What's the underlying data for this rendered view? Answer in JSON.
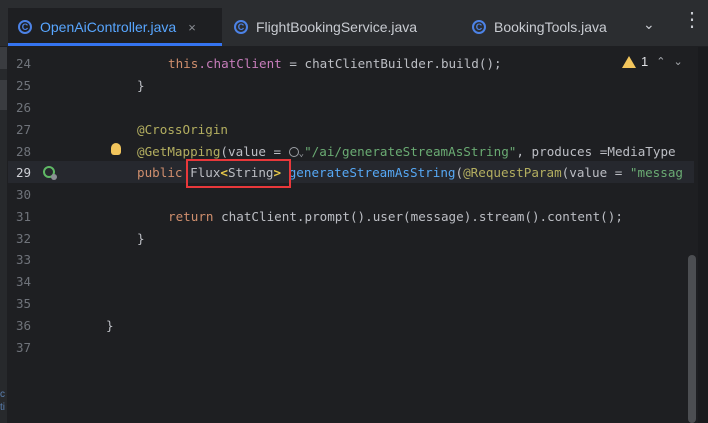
{
  "tabs": [
    {
      "label": "OpenAiController.java",
      "active": true,
      "close": "×"
    },
    {
      "label": "FlightBookingService.java",
      "active": false
    },
    {
      "label": "BookingTools.java",
      "active": false
    }
  ],
  "tab_icon_letter": "C",
  "tab_overflow_icon": "chevron-down-icon",
  "tab_more_icon": "more-vertical-icon",
  "inspection": {
    "warning_count": "1",
    "up": "⌃",
    "down": "⌄"
  },
  "line_numbers": [
    "24",
    "25",
    "26",
    "27",
    "28",
    "29",
    "30",
    "31",
    "32",
    "33",
    "34",
    "35",
    "36",
    "37"
  ],
  "code": {
    "l24_kw": "this",
    "l24_fld": ".chatClient",
    "l24_rest": " = chatClientBuilder.build();",
    "l25": "}",
    "l27": "@CrossOrigin",
    "l28_ann": "@GetMapping",
    "l28_open": "(value = ",
    "l28_str": "\"/ai/generateStreamAsString\"",
    "l28_rest": ", produces =MediaType",
    "l29_kw": "public ",
    "l29_type": "Flux",
    "l29_lt": "<",
    "l29_generic": "String",
    "l29_gt": ">",
    "l29_fn": " generateStreamAsString",
    "l29_paren": "(",
    "l29_ann": "@RequestParam",
    "l29_rest": "(value = ",
    "l29_str": "\"messag",
    "l31_kw": "return ",
    "l31_rest": "chatClient.prompt().user(message).stream().content();",
    "l32": "}",
    "l36": "}"
  },
  "left_strip_text": [
    "c",
    "ti"
  ]
}
